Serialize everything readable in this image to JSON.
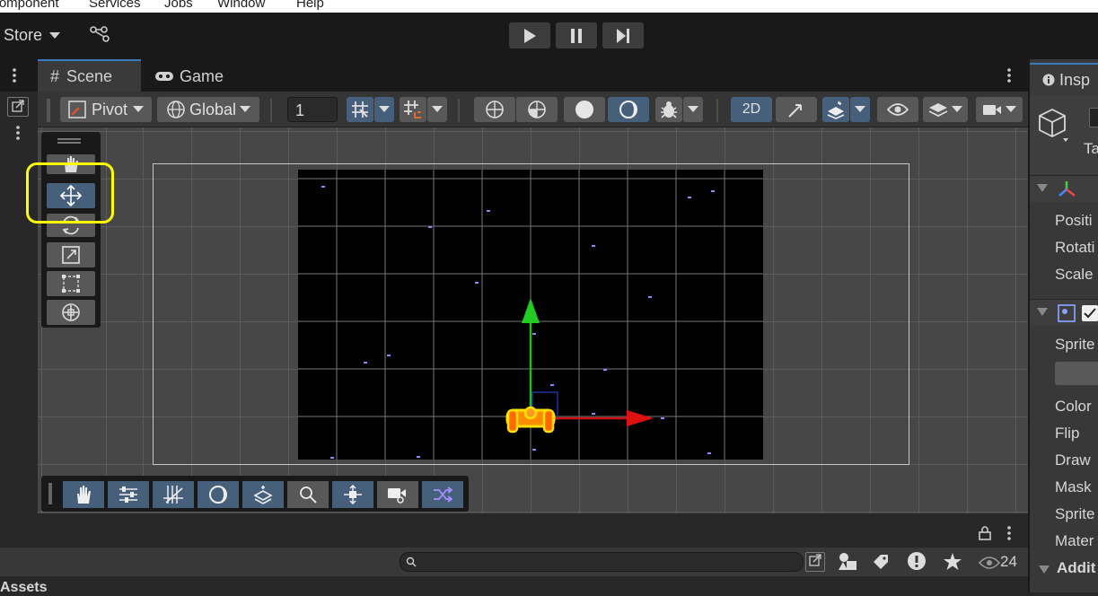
{
  "menubar": {
    "items": [
      "Component",
      "Services",
      "Jobs",
      "Window",
      "Help"
    ]
  },
  "toolbar": {
    "store_label": "Store",
    "play_icon": "play-icon",
    "pause_icon": "pause-icon",
    "step_icon": "step-icon"
  },
  "tabs": {
    "scene_label": "Scene",
    "game_label": "Game",
    "inspector_label": "Insp"
  },
  "scene_toolbar": {
    "pivot_label": "Pivot",
    "global_label": "Global",
    "grid_value": "1",
    "mode_2d_label": "2D"
  },
  "inspector": {
    "tag_label": "Ta",
    "transform_fields": [
      "Positi",
      "Rotati",
      "Scale"
    ],
    "sprite_fields": [
      "Sprite",
      "Color",
      "Flip",
      "Draw",
      "Mask",
      "Sprite",
      "Mater"
    ],
    "additional_label": "Addit"
  },
  "project": {
    "assets_label": "Assets",
    "hidden_count": "24"
  },
  "colors": {
    "accent": "#46607c",
    "highlight": "#ffff00",
    "axis_x": "#cc1111",
    "axis_y": "#22bb22"
  }
}
